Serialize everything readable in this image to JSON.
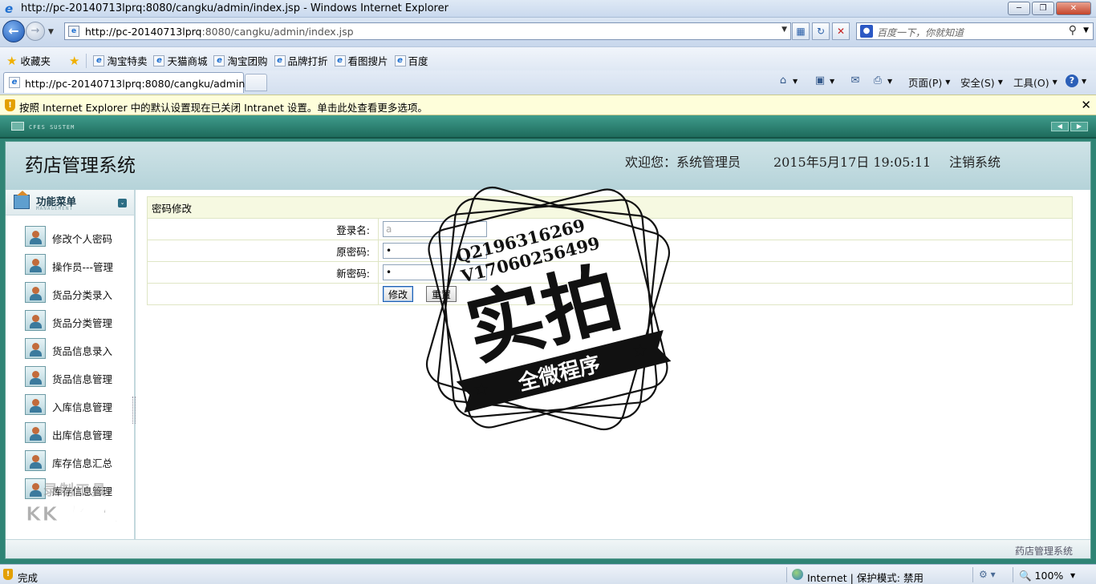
{
  "browser": {
    "window_title": "http://pc-20140713lprq:8080/cangku/admin/index.jsp - Windows Internet Explorer",
    "address_host": "http://pc-20140713lprq",
    "address_rest": ":8080/cangku/admin/index.jsp",
    "search_placeholder": "百度一下，你就知道",
    "favorites_label": "收藏夹",
    "favorites": [
      "淘宝特卖",
      "天猫商城",
      "淘宝团购",
      "品牌打折",
      "看图搜片",
      "百度"
    ],
    "tab_title": "http://pc-20140713lprq:8080/cangku/admin/...",
    "commands": {
      "page": "页面(P)",
      "safety": "安全(S)",
      "tools": "工具(O)"
    },
    "infobar_message": "按照 Internet Explorer 中的默认设置现在已关闭 Intranet 设置。单击此处查看更多选项。",
    "status_left": "完成",
    "status_zone": "Internet | 保护模式: 禁用",
    "zoom": "100%"
  },
  "app": {
    "system_tag": "CFES SUSTEM",
    "title": "药店管理系统",
    "welcome": "欢迎您：系统管理员",
    "datetime": "2015年5月17日  19:05:11",
    "logout": "注销系统",
    "menu_title": "功能菜单",
    "menu_subtitle": "MANAGEMENT",
    "menu_items": [
      "修改个人密码",
      "操作员---管理",
      "货品分类录入",
      "货品分类管理",
      "货品信息录入",
      "货品信息管理",
      "入库信息管理",
      "出库信息管理",
      "库存信息汇总",
      "库存信息管理"
    ],
    "footer": "药店管理系统"
  },
  "form": {
    "caption": "密码修改",
    "login_label": "登录名:",
    "login_value": "a",
    "old_label": "原密码:",
    "old_value": "a",
    "new_label": "新密码:",
    "new_value": "a",
    "submit_label": "修改",
    "reset_label": "重置"
  },
  "watermark": {
    "contact_1": "Q2196316269",
    "contact_2": "V17060256499",
    "main": "实拍",
    "ribbon": "全微程序",
    "recorder_1": "录制工具",
    "recorder_2": "KK录像机"
  }
}
